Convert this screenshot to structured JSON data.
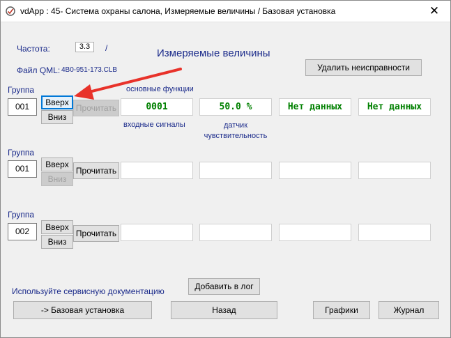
{
  "window": {
    "title": "vdApp : 45- Система охраны салона,  Измеряемые величины / Базовая установка",
    "close_glyph": "✕"
  },
  "info": {
    "frequency_label": "Частота:",
    "frequency_value": "3.3",
    "frequency_sep": "/",
    "qml_label": "Файл QML:",
    "qml_value": "4B0-951-173.CLB",
    "heading": "Измеряемые величины",
    "delete_faults_button": "Удалить неисправности"
  },
  "groups": [
    {
      "label": "Группа",
      "number": "001",
      "up": "Вверх",
      "down": "Вниз",
      "read": "Прочитать",
      "values": [
        "0001",
        "50.0 %",
        "Нет данных",
        "Нет данных"
      ],
      "captions_top": "основные функции",
      "caption_1": "входные сигналы",
      "caption_2": "датчик\nчувствительность"
    },
    {
      "label": "Группа",
      "number": "001",
      "up": "Вверх",
      "down": "Вниз",
      "read": "Прочитать",
      "values": [
        "",
        "",
        "",
        ""
      ]
    },
    {
      "label": "Группа",
      "number": "002",
      "up": "Вверх",
      "down": "Вниз",
      "read": "Прочитать",
      "values": [
        "",
        "",
        "",
        ""
      ]
    }
  ],
  "footer": {
    "note": "Используйте сервисную документацию",
    "add_log": "Добавить в лог",
    "basic_setup": "-> Базовая установка",
    "back": "Назад",
    "graphs": "Графики",
    "journal": "Журнал"
  },
  "colors": {
    "value_text": "#008000",
    "caption_text": "#1a2a8a",
    "annotation_arrow": "#e8322a",
    "focus_border": "#0078d7"
  },
  "icons": [
    "app-icon",
    "close-icon",
    "annotation-arrow-icon"
  ]
}
